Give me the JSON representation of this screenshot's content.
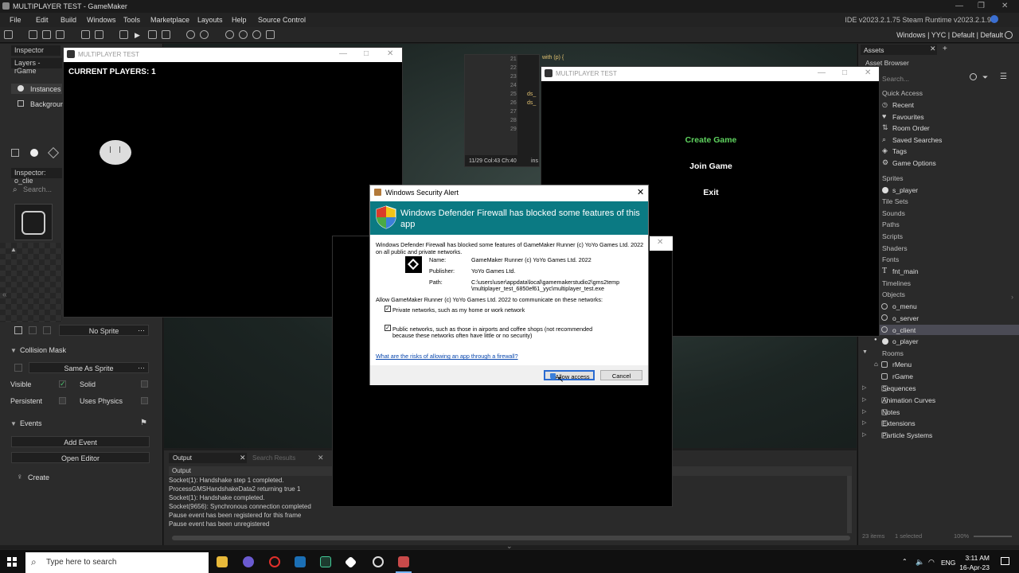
{
  "window": {
    "title": "MULTIPLAYER TEST - GameMaker",
    "ide_version": "IDE v2023.2.1.75  Steam  Runtime v2023.2.1.90"
  },
  "menu": [
    "File",
    "Edit",
    "Build",
    "Windows",
    "Tools",
    "Marketplace",
    "Layouts",
    "Help",
    "Source Control"
  ],
  "toolbar": {
    "right": "Windows | YYC | Default | Default"
  },
  "left": {
    "inspector_tab": "Inspector",
    "layers_tab": "Layers - rGame",
    "instances": "Instances",
    "background": "Background",
    "inspector2": "Inspector: o_clie",
    "search_placeholder": "Search...",
    "no_sprite": "No Sprite",
    "collision_mask": "Collision Mask",
    "same_as_sprite": "Same As Sprite",
    "visible": "Visible",
    "solid": "Solid",
    "persistent": "Persistent",
    "uses_physics": "Uses Physics",
    "events": "Events",
    "add_event": "Add Event",
    "open_editor": "Open Editor",
    "create": "Create"
  },
  "code": {
    "lines": [
      "21",
      "22",
      "23",
      "24",
      "25",
      "26",
      "27",
      "28",
      "29"
    ],
    "snippet": "with (p) {",
    "snippet2": "ds_",
    "snippet3": "ds_",
    "status": "11/29 Col:43 Ch:40",
    "status2": "ins"
  },
  "game1": {
    "caption": "MULTIPLAYER TEST",
    "players": "CURRENT PLAYERS: 1"
  },
  "game2": {
    "caption": "MULTIPLAYER TEST",
    "create": "Create Game",
    "join": "Join Game",
    "exit": "Exit"
  },
  "dialog": {
    "caption": "Windows Security Alert",
    "banner": "Windows Defender Firewall has blocked some features of this app",
    "intro": "Windows Defender Firewall has blocked some features of GameMaker Runner (c) YoYo Games Ltd. 2022 on all public and private networks.",
    "name_label": "Name:",
    "name_value": "GameMaker Runner (c) YoYo Games Ltd. 2022",
    "publisher_label": "Publisher:",
    "publisher_value": "YoYo Games Ltd.",
    "path_label": "Path:",
    "path_value1": "C:\\users\\user\\appdata\\local\\gamemakerstudio2\\gms2temp",
    "path_value2": "\\multiplayer_test_6850ef61_yyc\\multiplayer_test.exe",
    "allow_text": "Allow GameMaker Runner (c) YoYo Games Ltd. 2022 to communicate on these networks:",
    "private": "Private networks, such as my home or work network",
    "public1": "Public networks, such as those in airports and coffee shops (not recommended",
    "public2": "because these networks often have little or no security)",
    "link": "What are the risks of allowing an app through a firewall?",
    "allow": "Allow access",
    "cancel": "Cancel"
  },
  "output": {
    "tab": "Output",
    "search_tab": "Search Results",
    "title": "Output",
    "lines": [
      "Socket(1): Handshake step 1 completed.",
      "ProcessGMSHandshakeData2 returning true 1",
      "Socket(1): Handshake completed.",
      "Socket(9656): Synchronous connection completed",
      "Pause event has been registered for this frame",
      "Pause event has been unregistered"
    ]
  },
  "assets": {
    "tab": "Assets",
    "browser": "Asset Browser",
    "search": "Search...",
    "quick_access": "Quick Access",
    "quick": [
      "Recent",
      "Favourites",
      "Room Order",
      "Saved Searches",
      "Tags",
      "Game Options"
    ],
    "sprites": "Sprites",
    "s_player": "s_player",
    "tilesets": "Tile Sets",
    "sounds": "Sounds",
    "paths": "Paths",
    "scripts": "Scripts",
    "shaders": "Shaders",
    "fonts": "Fonts",
    "fnt_main": "fnt_main",
    "timelines": "Timelines",
    "objects": "Objects",
    "objs": [
      "o_menu",
      "o_server",
      "o_client",
      "o_player"
    ],
    "rooms": "Rooms",
    "rooms_list": [
      "rMenu",
      "rGame"
    ],
    "folders": [
      "Sequences",
      "Animation Curves",
      "Notes",
      "Extensions",
      "Particle Systems"
    ],
    "footer_items": "23 items",
    "footer_selected": "1 selected",
    "zoom": "100%"
  },
  "taskbar": {
    "search": "Type here to search",
    "lang": "ENG",
    "time": "3:11 AM",
    "date": "16-Apr-23"
  }
}
